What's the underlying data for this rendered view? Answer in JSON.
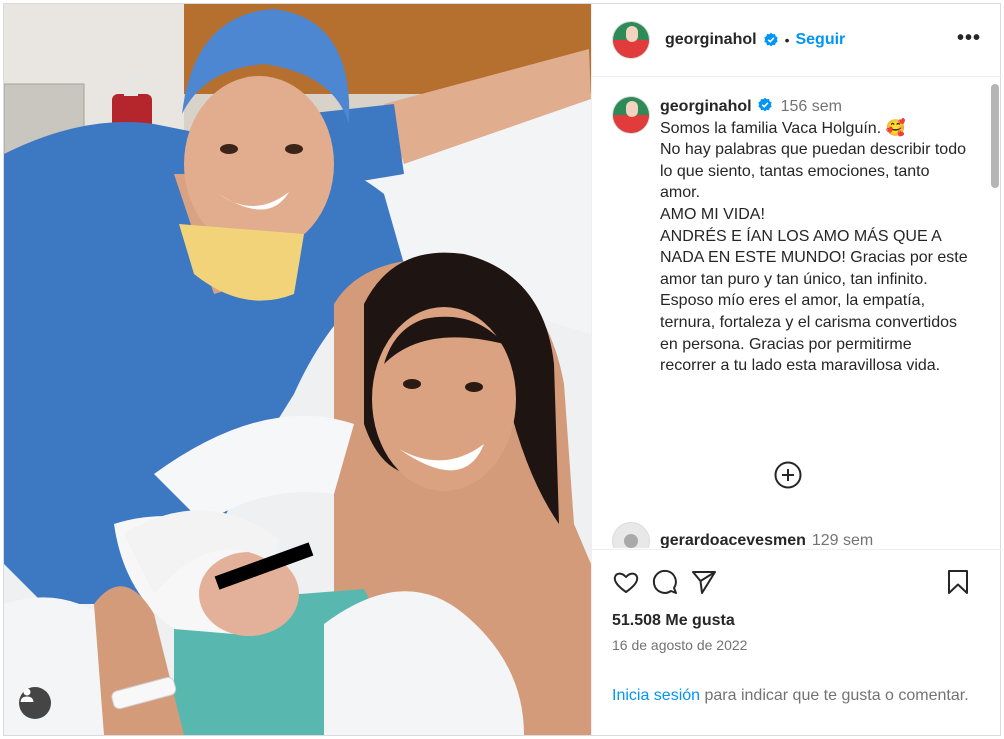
{
  "post": {
    "username": "georginahol",
    "follow_label": "Seguir",
    "separator": "•",
    "more_label": "•••"
  },
  "caption": {
    "username": "georginahol",
    "time": "156 sem",
    "text": "Somos la familia Vaca Holguín. 🥰\nNo hay palabras que puedan describir todo lo que siento, tantas emociones, tanto amor.\nAMO MI VIDA!\nANDRÉS E ÍAN LOS AMO MÁS QUE A NADA EN ESTE MUNDO! Gracias por este amor tan puro y tan único, tan infinito.\nEsposo mío eres el amor, la empatía, ternura, fortaleza y el carisma convertidos en persona. Gracias por permitirme recorrer a tu lado esta maravillosa vida."
  },
  "comment": {
    "username": "gerardoacevesmen",
    "time": "129 sem"
  },
  "stats": {
    "likes": "51.508 Me gusta",
    "date": "16 de agosto de 2022"
  },
  "login_prompt": {
    "link": "Inicia sesión",
    "rest": " para indicar que te gusta o comentar."
  },
  "icons": {
    "user_tag": "user-icon",
    "verified": "verified-badge-icon",
    "like": "heart-icon",
    "comment": "comment-icon",
    "share": "paper-plane-icon",
    "save": "bookmark-icon",
    "load_more": "plus-circle-icon"
  },
  "colors": {
    "accent": "#0095f6",
    "verified": "#0095f6",
    "muted": "#737373"
  }
}
